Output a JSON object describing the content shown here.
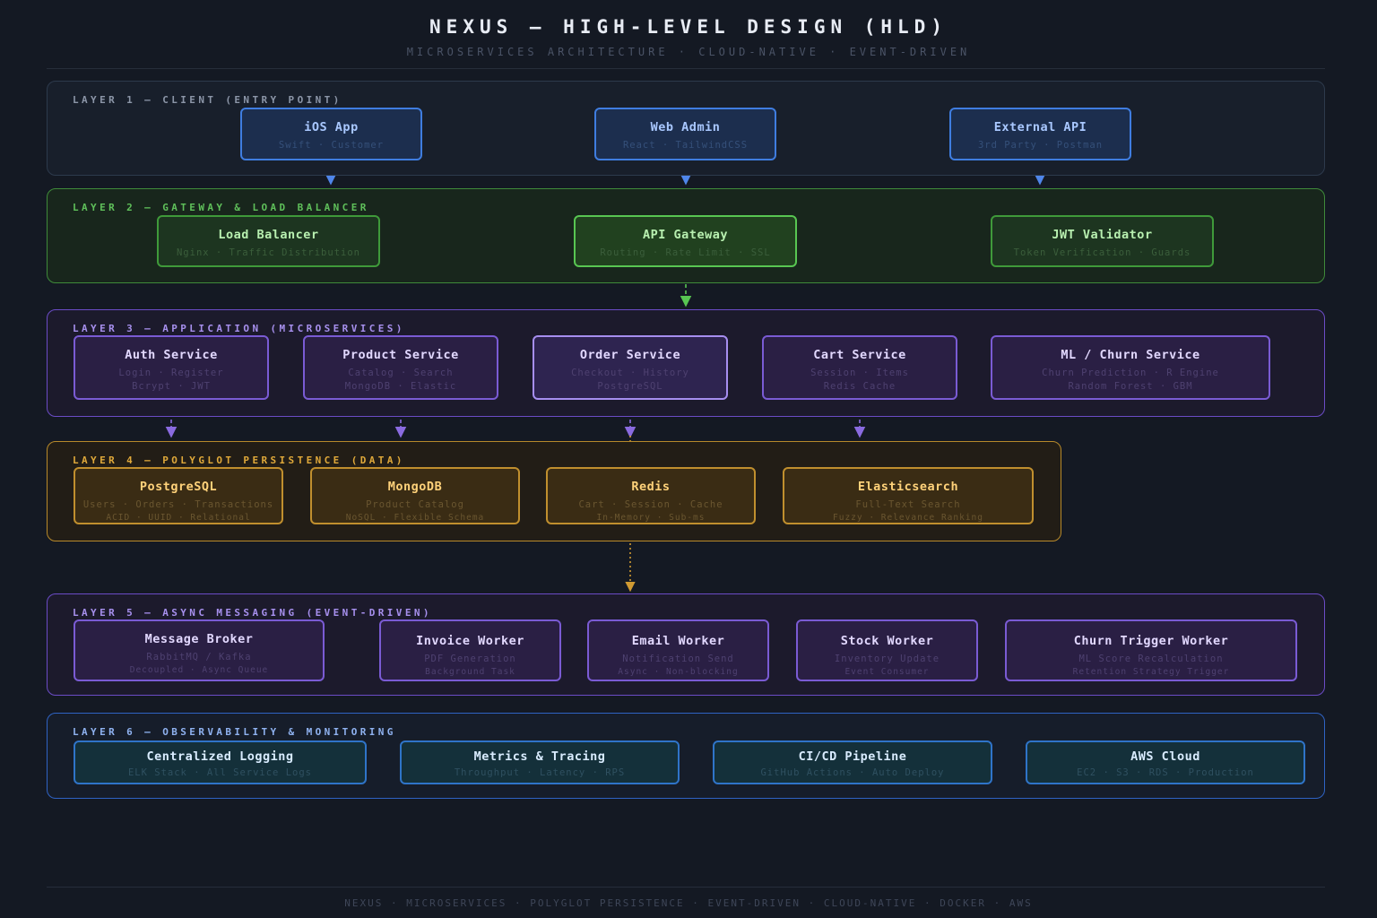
{
  "header": {
    "title": "NEXUS — HIGH-LEVEL DESIGN (HLD)",
    "subtitle": "MICROSERVICES ARCHITECTURE · CLOUD-NATIVE · EVENT-DRIVEN"
  },
  "layers": [
    {
      "title": "LAYER 1 — CLIENT (ENTRY POINT)",
      "color": "#3f7de0",
      "nodes": [
        {
          "title": "iOS App",
          "sub": [
            "Swift · Customer"
          ]
        },
        {
          "title": "Web Admin",
          "sub": [
            "React · TailwindCSS"
          ]
        },
        {
          "title": "External API",
          "sub": [
            "3rd Party · Postman"
          ]
        }
      ]
    },
    {
      "title": "LAYER 2 — GATEWAY & LOAD BALANCER",
      "color": "#58c652",
      "nodes": [
        {
          "title": "Load Balancer",
          "sub": [
            "Nginx · Traffic Distribution"
          ]
        },
        {
          "title": "API Gateway",
          "sub": [
            "Routing · Rate Limit · SSL"
          ]
        },
        {
          "title": "JWT Validator",
          "sub": [
            "Token Verification · Guards"
          ]
        }
      ]
    },
    {
      "title": "LAYER 3 — APPLICATION (MICROSERVICES)",
      "color": "#7a5bd4",
      "nodes": [
        {
          "title": "Auth Service",
          "sub": [
            "Login · Register",
            "Bcrypt · JWT"
          ]
        },
        {
          "title": "Product Service",
          "sub": [
            "Catalog · Search",
            "MongoDB · Elastic"
          ]
        },
        {
          "title": "Order Service",
          "sub": [
            "Checkout · History",
            "PostgreSQL"
          ]
        },
        {
          "title": "Cart Service",
          "sub": [
            "Session · Items",
            "Redis Cache"
          ]
        },
        {
          "title": "ML / Churn Service",
          "sub": [
            "Churn Prediction · R Engine",
            "Random Forest · GBM"
          ]
        }
      ]
    },
    {
      "title": "LAYER 4 — POLYGLOT PERSISTENCE (DATA)",
      "color": "#c08f2e",
      "nodes": [
        {
          "title": "PostgreSQL",
          "sub": [
            "Users · Orders · Transactions",
            "ACID · UUID · Relational"
          ]
        },
        {
          "title": "MongoDB",
          "sub": [
            "Product Catalog",
            "NoSQL · Flexible Schema"
          ]
        },
        {
          "title": "Redis",
          "sub": [
            "Cart · Session · Cache",
            "In-Memory · Sub-ms"
          ]
        },
        {
          "title": "Elasticsearch",
          "sub": [
            "Full-Text Search",
            "Fuzzy · Relevance Ranking"
          ]
        }
      ]
    },
    {
      "title": "LAYER 5 — ASYNC MESSAGING (EVENT-DRIVEN)",
      "color": "#7a5bd4",
      "nodes": [
        {
          "title": "Message Broker",
          "sub": [
            "RabbitMQ / Kafka",
            "Decoupled · Async Queue"
          ]
        },
        {
          "title": "Invoice Worker",
          "sub": [
            "PDF Generation",
            "Background Task"
          ]
        },
        {
          "title": "Email Worker",
          "sub": [
            "Notification Send",
            "Async · Non-blocking"
          ]
        },
        {
          "title": "Stock Worker",
          "sub": [
            "Inventory Update",
            "Event Consumer"
          ]
        },
        {
          "title": "Churn Trigger Worker",
          "sub": [
            "ML Score Recalculation",
            "Retention Strategy Trigger"
          ]
        }
      ]
    },
    {
      "title": "LAYER 6 — OBSERVABILITY & MONITORING",
      "color": "#2f74c8",
      "nodes": [
        {
          "title": "Centralized Logging",
          "sub": [
            "ELK Stack · All Service Logs"
          ]
        },
        {
          "title": "Metrics & Tracing",
          "sub": [
            "Throughput · Latency · RPS"
          ]
        },
        {
          "title": "CI/CD Pipeline",
          "sub": [
            "GitHub Actions · Auto Deploy"
          ]
        },
        {
          "title": "AWS Cloud",
          "sub": [
            "EC2 · S3 · RDS · Production"
          ]
        }
      ]
    }
  ],
  "footer": "NEXUS · MICROSERVICES · POLYGLOT PERSISTENCE · EVENT-DRIVEN · CLOUD-NATIVE · DOCKER · AWS"
}
